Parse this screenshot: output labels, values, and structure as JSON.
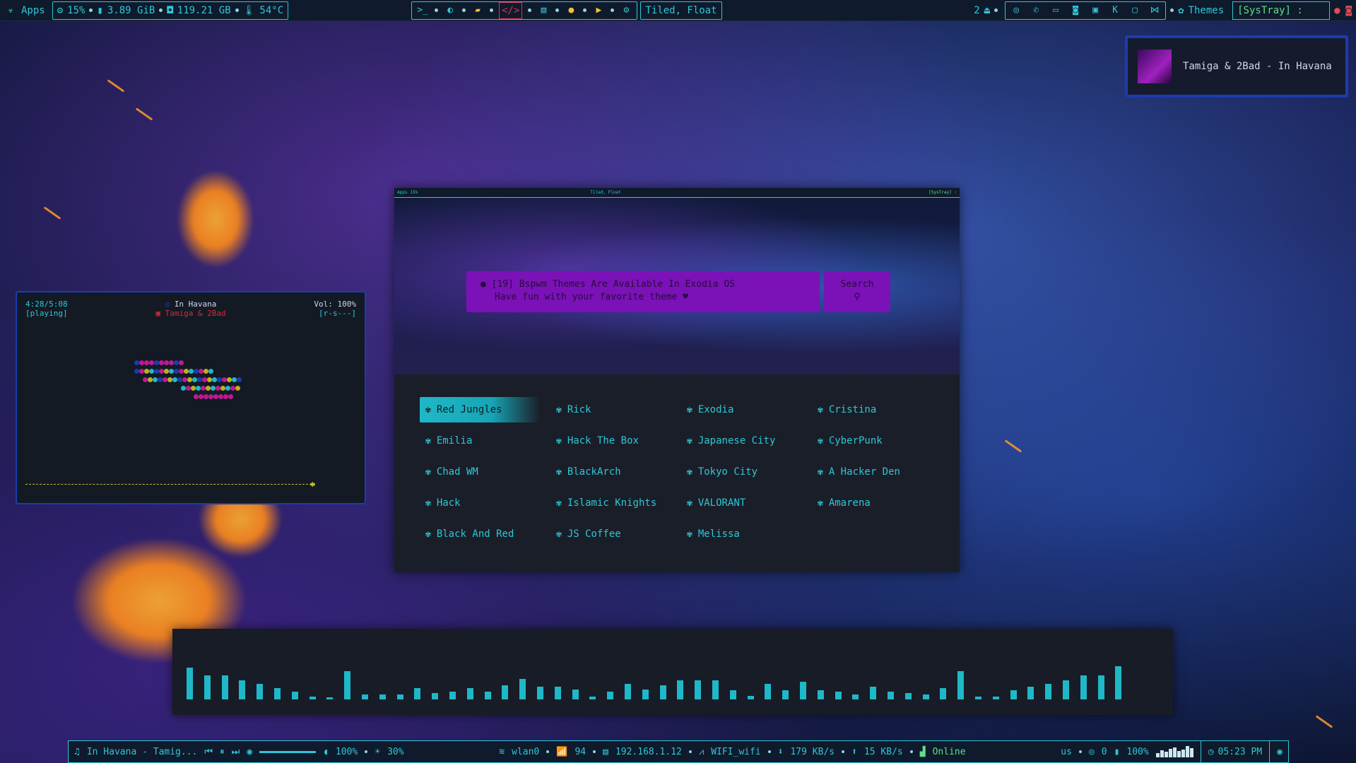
{
  "topbar": {
    "apps_label": "Apps",
    "cpu": "15%",
    "ram": "3.89 GiB",
    "disk": "119.21 GB",
    "temp": "54°C",
    "layout": "Tiled, Float",
    "desktop_num": "2",
    "themes_label": "Themes",
    "systray_label": "[SysTray] :"
  },
  "notification": {
    "text": "Tamiga & 2Bad - In Havana"
  },
  "player": {
    "time": "4:28/5:08",
    "state": "[playing]",
    "track": "In Havana",
    "artist": "Tamiga & 2Bad",
    "volume": "Vol: 100%",
    "flags": "[r-s---]"
  },
  "theme_window": {
    "message_line1": "[19] Bspwm Themes Are Available In Exodia OS",
    "message_line2": "Have fun with your favorite theme",
    "search_label": "Search",
    "themes": [
      "Red Jungles",
      "Rick",
      "Exodia",
      "Cristina",
      "Emilia",
      "Hack The Box",
      "Japanese City",
      "CyberPunk",
      "Chad WM",
      "BlackArch",
      "Tokyo City",
      "A Hacker Den",
      "Hack",
      "Islamic Knights",
      "VALORANT",
      "Amarena",
      "Black And Red",
      "JS Coffee",
      "Melissa"
    ],
    "selected": "Red Jungles"
  },
  "visualizer": {
    "levels": [
      0.5,
      0.38,
      0.38,
      0.3,
      0.25,
      0.18,
      0.12,
      0.04,
      0.02,
      0.44,
      0.08,
      0.08,
      0.08,
      0.18,
      0.1,
      0.12,
      0.18,
      0.12,
      0.22,
      0.32,
      0.2,
      0.2,
      0.16,
      0.05,
      0.12,
      0.25,
      0.16,
      0.22,
      0.3,
      0.3,
      0.3,
      0.14,
      0.06,
      0.25,
      0.14,
      0.28,
      0.15,
      0.12,
      0.08,
      0.2,
      0.12,
      0.1,
      0.08,
      0.18,
      0.44,
      0.04,
      0.04,
      0.14,
      0.2,
      0.25,
      0.3,
      0.38,
      0.38,
      0.52
    ]
  },
  "bottombar": {
    "now_playing": "In Havana - Tamig...",
    "volume": "100%",
    "brightness": "30%",
    "interface": "wlan0",
    "signal": "94",
    "ip": "192.168.1.12",
    "ssid": "WIFI_wifi",
    "down": "179 KB/s",
    "up": "15 KB/s",
    "status": "Online",
    "keyboard": "us",
    "notifications": "0",
    "battery": "100%",
    "clock": "05:23 PM"
  },
  "colors": {
    "accent": "#2ec7d6",
    "purple": "#7a12b8",
    "alert": "#e0314a",
    "border_blue": "#1c3bb0"
  }
}
